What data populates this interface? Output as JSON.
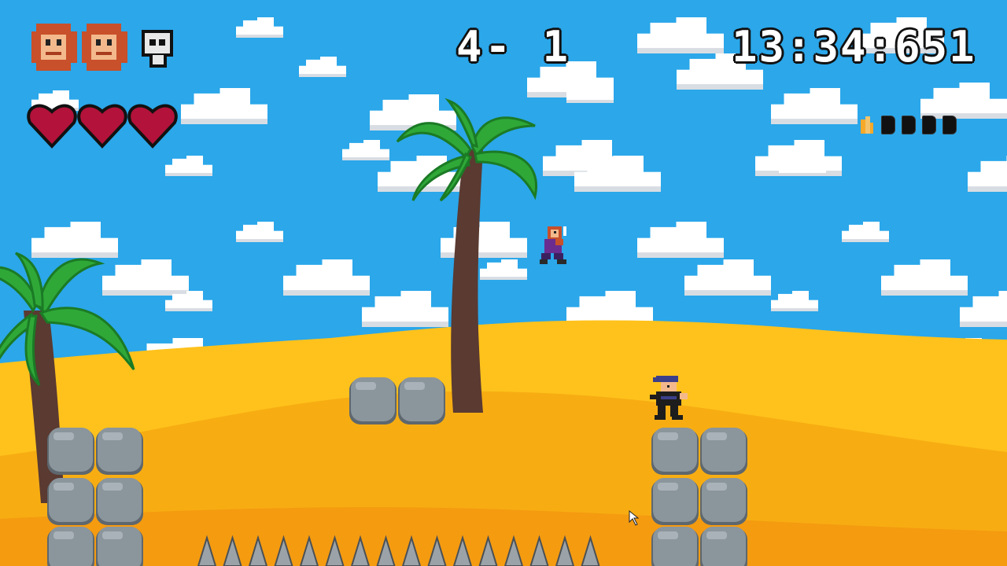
{
  "hud": {
    "level": "4- 1",
    "timer": "13:34:651",
    "lives": [
      {
        "state": "alive",
        "icon": "player-head-icon"
      },
      {
        "state": "alive",
        "icon": "player-head-icon"
      },
      {
        "state": "lost",
        "icon": "skull-icon"
      }
    ],
    "health_hearts": 3,
    "collectibles": {
      "icon": "gem-icon",
      "collected": 0,
      "total": 4
    }
  },
  "colors": {
    "sky": "#2ba7ea",
    "sand_light": "#ffc21c",
    "sand_mid": "#f7ad12",
    "sand_dark": "#f59b10",
    "palm_leaf": "#2fa838",
    "palm_trunk": "#5a3a31",
    "rock": "#8b959c",
    "heart": "#b3123a"
  },
  "characters": {
    "player": {
      "name": "player-character",
      "icon": "red-haired-hero"
    },
    "enemy": {
      "name": "ninja-enemy",
      "icon": "ninja"
    }
  },
  "hazards": {
    "spikes": 16
  }
}
